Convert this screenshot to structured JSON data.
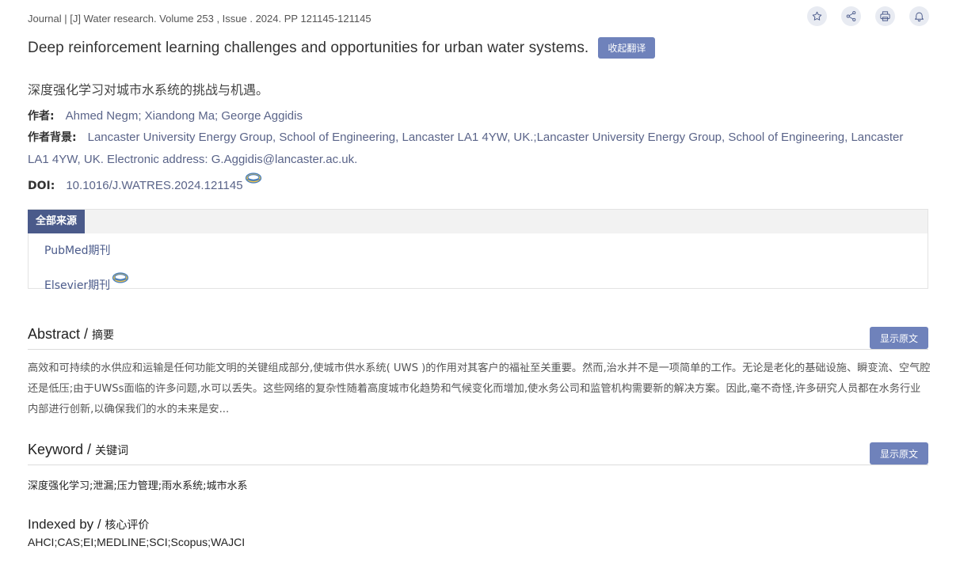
{
  "journal_line": "Journal | [J] Water research. Volume 253 , Issue . 2024. PP 121145-121145",
  "actions": [
    {
      "name": "star-icon"
    },
    {
      "name": "share-icon"
    },
    {
      "name": "print-icon"
    },
    {
      "name": "bell-icon"
    }
  ],
  "title_en": "Deep reinforcement learning challenges and opportunities for urban water systems.",
  "collapse_translation_label": "收起翻译",
  "title_cn": "深度强化学习对城市水系统的挑战与机遇。",
  "authors": {
    "label": "作者:",
    "value": "Ahmed Negm; Xiandong Ma; George Aggidis"
  },
  "affiliation": {
    "label": "作者背景:",
    "value": "Lancaster University Energy Group, School of Engineering, Lancaster LA1 4YW, UK.;Lancaster University Energy Group, School of Engineering, Lancaster LA1 4YW, UK. Electronic address: G.Aggidis@lancaster.ac.uk."
  },
  "doi": {
    "label": "DOI:",
    "value": "10.1016/J.WATRES.2024.121145"
  },
  "sources": {
    "tab_label": "全部来源",
    "items": [
      "PubMed期刊",
      "Elsevier期刊"
    ]
  },
  "abstract": {
    "title_en": "Abstract / ",
    "title_cn": "摘要",
    "button_label": "显示原文",
    "text": "高效和可持续的水供应和运输是任何功能文明的关键组成部分,使城市供水系统( UWS )的作用对其客户的福祉至关重要。然而,治水并不是一项简单的工作。无论是老化的基础设施、瞬变流、空气腔还是低压;由于UWSs面临的许多问题,水可以丢失。这些网络的复杂性随着高度城市化趋势和气候变化而增加,使水务公司和监管机构需要新的解决方案。因此,毫不奇怪,许多研究人员都在水务行业内部进行创新,以确保我们的水的未来是安..."
  },
  "keyword": {
    "title_en": "Keyword / ",
    "title_cn": "关键词",
    "button_label": "显示原文",
    "text": "深度强化学习;泄漏;压力管理;雨水系统;城市水系"
  },
  "indexed": {
    "title_en": "Indexed by / ",
    "title_cn": "核心评价",
    "text": "AHCI;CAS;EI;MEDLINE;SCI;Scopus;WAJCI"
  },
  "colors": {
    "accent": "#6f82bb",
    "tab_active": "#4a5a8a",
    "link": "#4a5a8a"
  }
}
